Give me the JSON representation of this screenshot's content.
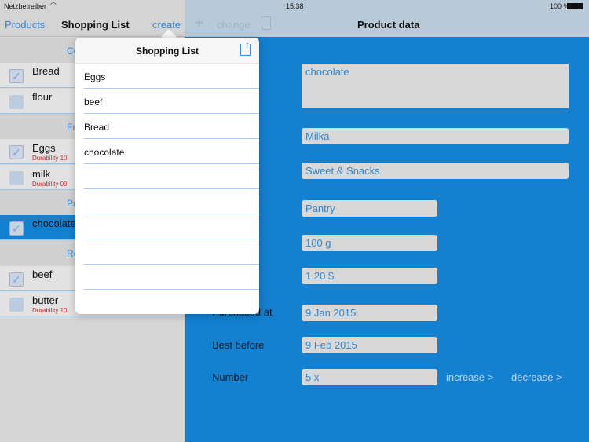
{
  "status": {
    "carrier": "Netzbetreiber",
    "time": "15:38",
    "battery": "100 %"
  },
  "left_nav": {
    "back": "Products",
    "title": "Shopping List",
    "create": "create"
  },
  "right_nav": {
    "add_icon": "plus-icon",
    "change": "change",
    "trash_icon": "trash-icon",
    "title": "Product data"
  },
  "list": [
    {
      "type": "section",
      "label": "Ce"
    },
    {
      "type": "item",
      "name": "Bread",
      "checked": true
    },
    {
      "type": "item",
      "name": "flour",
      "checked": false
    },
    {
      "type": "section",
      "label": "Fr"
    },
    {
      "type": "item",
      "name": "Eggs",
      "checked": true,
      "durability": "Durability 10"
    },
    {
      "type": "item",
      "name": "milk",
      "checked": false,
      "durability": "Durability 09"
    },
    {
      "type": "section",
      "label": "Pa"
    },
    {
      "type": "item",
      "name": "chocolate",
      "checked": true,
      "selected": true
    },
    {
      "type": "section",
      "label": "Re"
    },
    {
      "type": "item",
      "name": "beef",
      "checked": true
    },
    {
      "type": "item",
      "name": "butter",
      "checked": false,
      "durability": "Durability 10"
    }
  ],
  "popover": {
    "title": "Shopping List",
    "share_icon": "share-icon",
    "items": [
      "Eggs",
      "beef",
      "Bread",
      "chocolate",
      "",
      "",
      "",
      "",
      "",
      ""
    ]
  },
  "product": {
    "name": "chocolate",
    "brand": "Milka",
    "category": "Sweet & Snacks",
    "location": "Pantry",
    "amount": "100 g",
    "price": "1.20 $",
    "purchased_label": "Purchased at",
    "purchased": "9 Jan 2015",
    "best_before_label": "Best before",
    "best_before": "9 Feb 2015",
    "number_label": "Number",
    "number": "5 x",
    "increase": "increase >",
    "decrease": "decrease >"
  },
  "colors": {
    "accent": "#1380d0",
    "link": "#3a8ed8",
    "warning": "#d2232a"
  }
}
